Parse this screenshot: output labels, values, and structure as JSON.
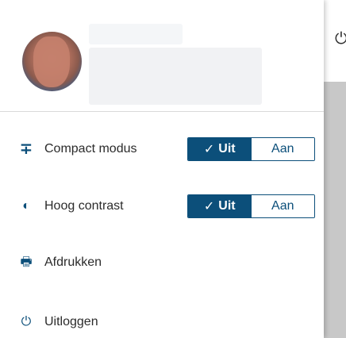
{
  "colors": {
    "accent": "#0c4f7a",
    "divider": "#d9d9d9",
    "content_gray": "#c8c8c8"
  },
  "menu": {
    "items": [
      {
        "icon": "compact-icon",
        "glyph": "∓",
        "label": "Compact modus",
        "toggle": {
          "off_label": "Uit",
          "on_label": "Aan",
          "selected": "Uit",
          "check_glyph": "✓"
        }
      },
      {
        "icon": "contrast-icon",
        "glyph": "◐",
        "label": "Hoog contrast",
        "toggle": {
          "off_label": "Uit",
          "on_label": "Aan",
          "selected": "Uit",
          "check_glyph": "✓"
        }
      },
      {
        "icon": "printer-icon",
        "glyph": "🖶",
        "label": "Afdrukken"
      },
      {
        "icon": "power-icon",
        "glyph": "⏻",
        "label": "Uitloggen"
      }
    ]
  },
  "page": {
    "topbar_icon": "power-icon",
    "topbar_glyph": "⏻"
  }
}
